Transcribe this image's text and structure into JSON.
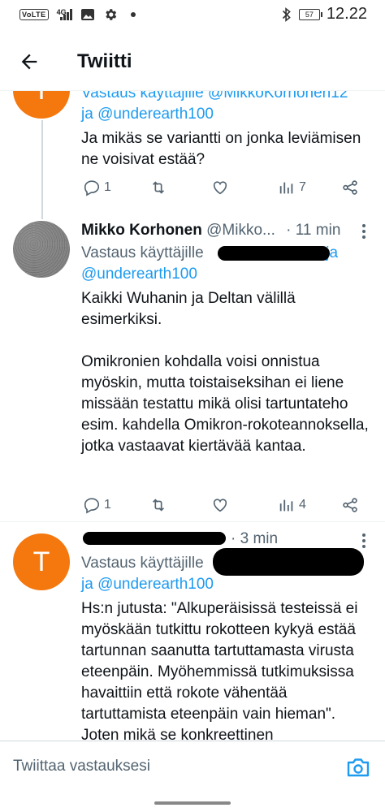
{
  "status_bar": {
    "volte": "VoLTE",
    "network": "4G",
    "battery": "57",
    "time": "12.22",
    "icons": [
      "signal-icon",
      "image-icon",
      "gear-icon",
      "dot-icon",
      "bluetooth-icon",
      "battery-icon"
    ]
  },
  "header": {
    "title": "Twiitti",
    "back_icon": "arrow-left-icon"
  },
  "tweets": [
    {
      "reply_line1": "Vastaus käyttäjille @MikkoKorhonen12",
      "reply_line2": "ja @underearth100",
      "avatar_letter": "T",
      "text": "Ja mikäs se variantti on jonka leviämisen ne voisivat estää?",
      "actions": {
        "replies": "1",
        "retweets": "",
        "likes": "",
        "views": "7"
      }
    },
    {
      "name": "Mikko Korhonen",
      "handle": "@Mikko...",
      "time": "· 11 min",
      "reply_prefix": "Vastaus käyttäjille",
      "reply_suffix": "ja",
      "reply_line2": "@underearth100",
      "text": "Kaikki Wuhanin ja Deltan välillä esimerkiksi.\n\nOmikronien kohdalla voisi onnistua myöskin, mutta toistaiseksihan ei liene missään testattu mikä olisi tartuntateho esim. kahdella Omikron-rokoteannoksella, jotka vastaavat kiertävää kantaa.",
      "actions": {
        "replies": "1",
        "retweets": "",
        "likes": "",
        "views": "4"
      }
    },
    {
      "avatar_letter": "T",
      "time": "· 3 min",
      "reply_prefix": "Vastaus käyttäjille",
      "reply_line2": "ja @underearth100",
      "text": "Hs:n jutusta: \"Alkuperäisissä testeissä ei myöskään tutkittu rokotteen kykyä estää tartunnan saanutta tartuttamasta virusta eteenpäin. Myöhemmissä tutkimuksissa havaittiin että rokote vähentää tartuttamista eteenpäin vain hieman\". Joten mikä se konkreettinen"
    }
  ],
  "compose": {
    "placeholder": "Twiittaa vastauksesi",
    "camera_icon": "camera-icon"
  },
  "colors": {
    "link": "#1d9bf0",
    "muted": "#536471",
    "avatar_orange": "#f4780e"
  }
}
